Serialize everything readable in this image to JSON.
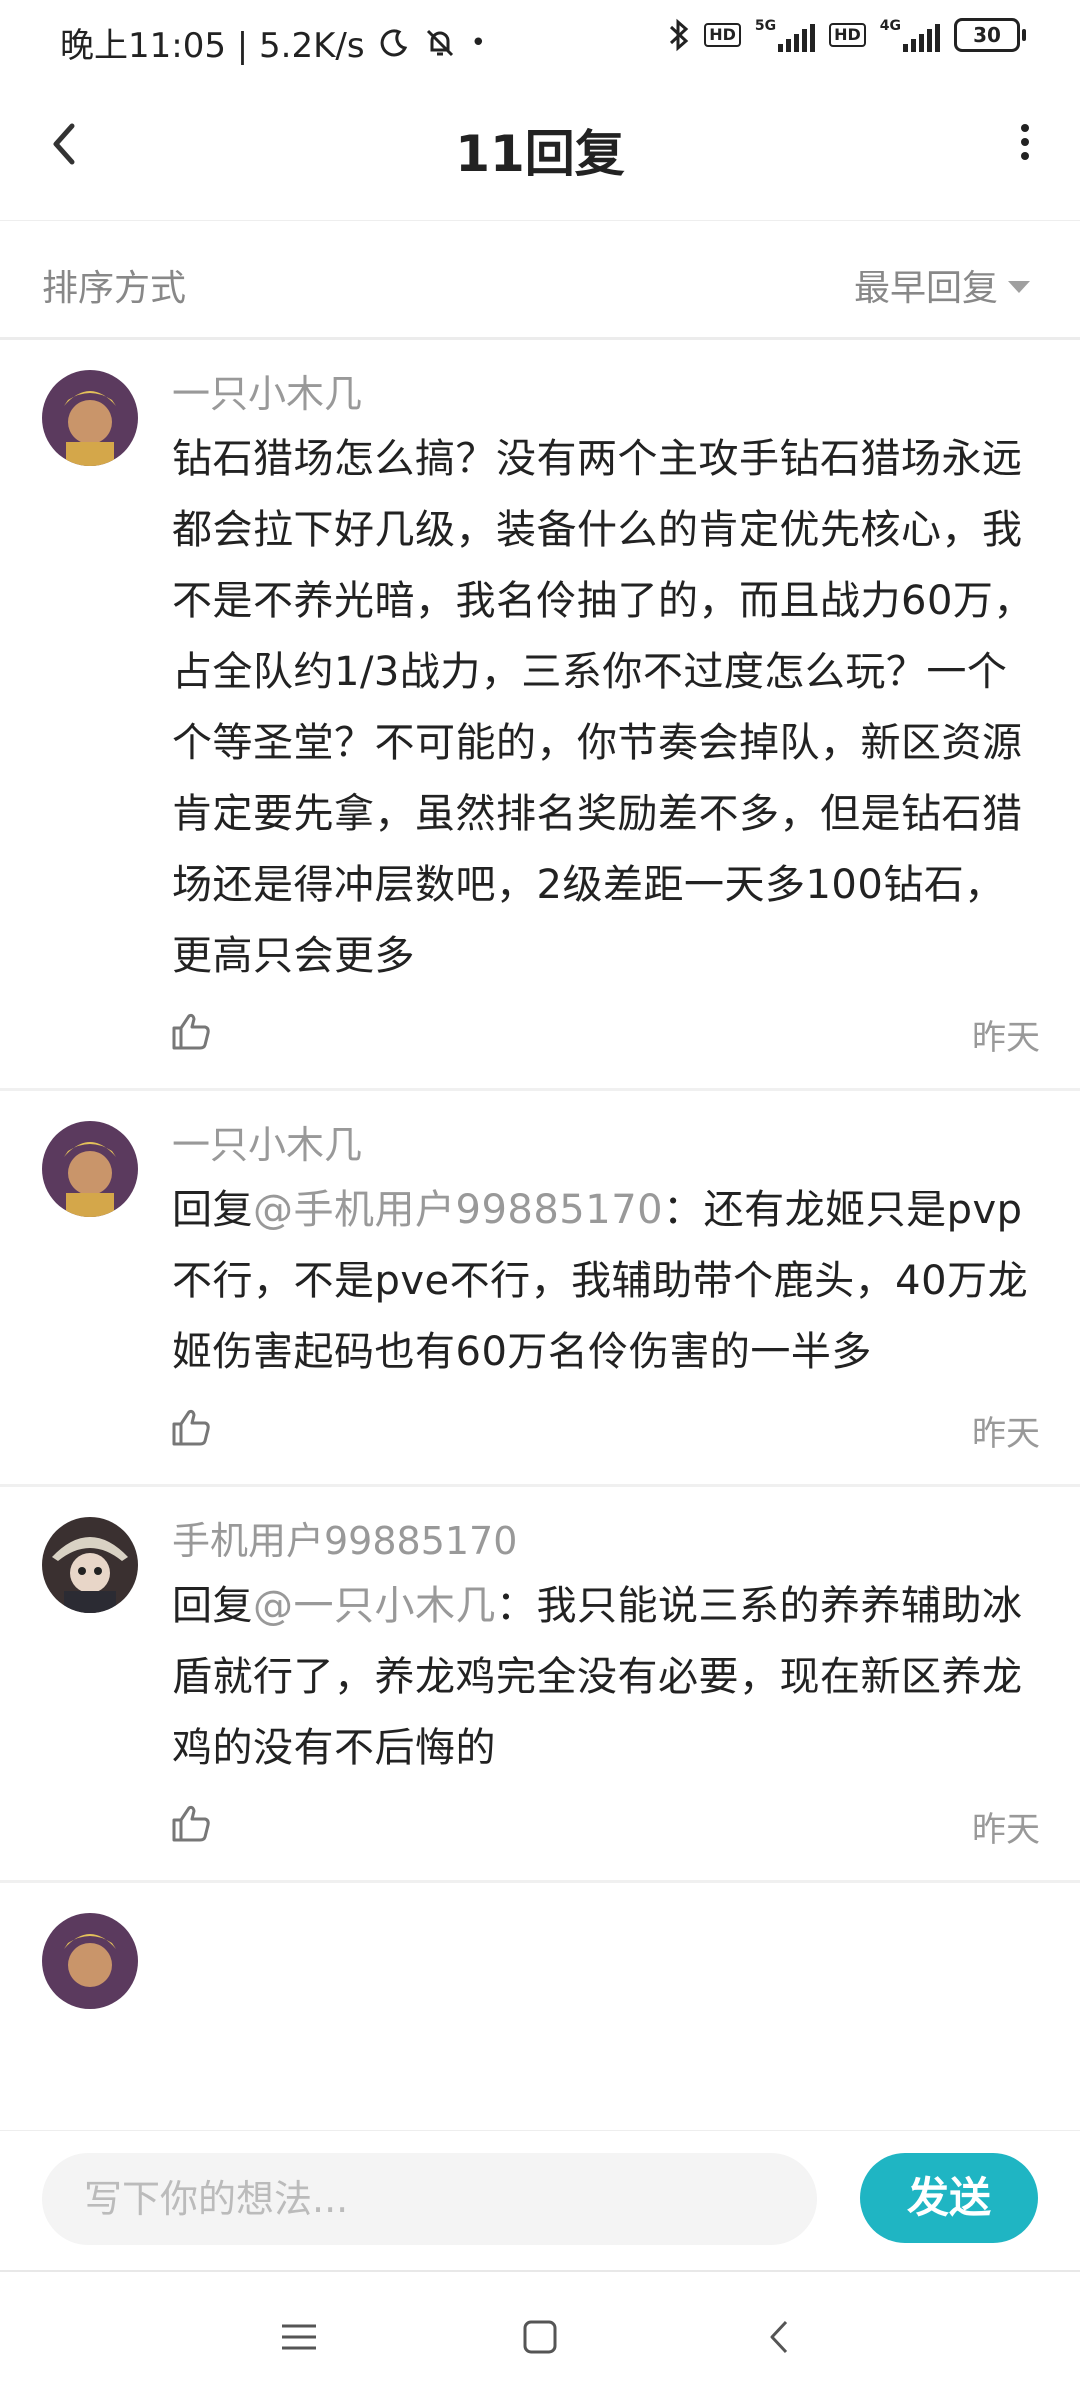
{
  "status_bar": {
    "time_speed": "晚上11:05 | 5.2K/s",
    "hd1": "HD",
    "net1": "5G",
    "hd2": "HD",
    "net2": "4G",
    "battery": "30"
  },
  "header": {
    "title": "11回复",
    "back_icon": "chevron-left-icon",
    "more_icon": "more-vertical-icon"
  },
  "sort": {
    "label": "排序方式",
    "value": "最早回复"
  },
  "comments": [
    {
      "username": "一只小木几",
      "reply_prefix": "",
      "mention": "",
      "text": "钻石猎场怎么搞？没有两个主攻手钻石猎场永远都会拉下好几级，装备什么的肯定优先核心，我不是不养光暗，我名伶抽了的，而且战力60万，占全队约1/3战力，三系你不过度怎么玩？一个个等圣堂？不可能的，你节奏会掉队，新区资源肯定要先拿，虽然排名奖励差不多，但是钻石猎场还是得冲层数吧，2级差距一天多100钻石，更高只会更多",
      "time": "昨天"
    },
    {
      "username": "一只小木几",
      "reply_prefix": "回复",
      "mention": "@手机用户99885170",
      "text": "：还有龙姬只是pvp不行，不是pve不行，我辅助带个鹿头，40万龙姬伤害起码也有60万名伶伤害的一半多",
      "time": "昨天"
    },
    {
      "username": "手机用户99885170",
      "reply_prefix": "回复",
      "mention": "@一只小木几",
      "text": "：我只能说三系的养养辅助冰盾就行了，养龙鸡完全没有必要，现在新区养龙鸡的没有不后悔的",
      "time": "昨天"
    }
  ],
  "input": {
    "placeholder": "写下你的想法...",
    "send_label": "发送"
  },
  "colors": {
    "accent": "#1fb5c3",
    "muted_text": "#999999"
  }
}
